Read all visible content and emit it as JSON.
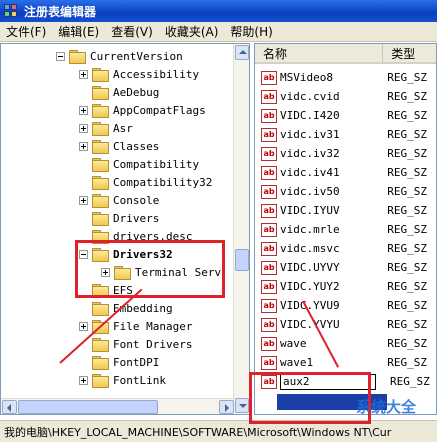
{
  "window": {
    "title": "注册表编辑器"
  },
  "menu": [
    "文件(F)",
    "编辑(E)",
    "查看(V)",
    "收藏夹(A)",
    "帮助(H)"
  ],
  "tree": [
    {
      "label": "CurrentVersion",
      "expander": "minus",
      "level": 0
    },
    {
      "label": "Accessibility",
      "expander": "plus",
      "level": 1
    },
    {
      "label": "AeDebug",
      "expander": "none",
      "level": 1
    },
    {
      "label": "AppCompatFlags",
      "expander": "plus",
      "level": 1
    },
    {
      "label": "Asr",
      "expander": "plus",
      "level": 1
    },
    {
      "label": "Classes",
      "expander": "plus",
      "level": 1
    },
    {
      "label": "Compatibility",
      "expander": "none",
      "level": 1
    },
    {
      "label": "Compatibility32",
      "expander": "none",
      "level": 1
    },
    {
      "label": "Console",
      "expander": "plus",
      "level": 1
    },
    {
      "label": "Drivers",
      "expander": "none",
      "level": 1
    },
    {
      "label": "drivers.desc",
      "expander": "none",
      "level": 1
    },
    {
      "label": "Drivers32",
      "expander": "minus",
      "level": 1,
      "selected": true
    },
    {
      "label": "Terminal Serv",
      "expander": "plus",
      "level": 2
    },
    {
      "label": "EFS",
      "expander": "none",
      "level": 1
    },
    {
      "label": "Embedding",
      "expander": "none",
      "level": 1
    },
    {
      "label": "File Manager",
      "expander": "plus",
      "level": 1
    },
    {
      "label": "Font Drivers",
      "expander": "none",
      "level": 1
    },
    {
      "label": "FontDPI",
      "expander": "none",
      "level": 1
    },
    {
      "label": "FontLink",
      "expander": "plus",
      "level": 1
    }
  ],
  "list": {
    "headers": {
      "name": "名称",
      "type": "类型"
    },
    "rows": [
      {
        "name": "MSVideo8",
        "type": "REG_SZ"
      },
      {
        "name": "vidc.cvid",
        "type": "REG_SZ"
      },
      {
        "name": "VIDC.I420",
        "type": "REG_SZ"
      },
      {
        "name": "vidc.iv31",
        "type": "REG_SZ"
      },
      {
        "name": "vidc.iv32",
        "type": "REG_SZ"
      },
      {
        "name": "vidc.iv41",
        "type": "REG_SZ"
      },
      {
        "name": "vidc.iv50",
        "type": "REG_SZ"
      },
      {
        "name": "VIDC.IYUV",
        "type": "REG_SZ"
      },
      {
        "name": "vidc.mrle",
        "type": "REG_SZ"
      },
      {
        "name": "vidc.msvc",
        "type": "REG_SZ"
      },
      {
        "name": "VIDC.UYVY",
        "type": "REG_SZ"
      },
      {
        "name": "VIDC.YUY2",
        "type": "REG_SZ"
      },
      {
        "name": "VIDC.YVU9",
        "type": "REG_SZ"
      },
      {
        "name": "VIDC.YVYU",
        "type": "REG_SZ"
      },
      {
        "name": "wave",
        "type": "REG_SZ"
      },
      {
        "name": "wave1",
        "type": "REG_SZ"
      }
    ],
    "rename_value": "aux2",
    "rename_type": "REG_SZ"
  },
  "status": "我的电脑\\HKEY_LOCAL_MACHINE\\SOFTWARE\\Microsoft\\Windows NT\\Cur",
  "icons": {
    "value": "ab",
    "app": "registry-editor-icon"
  },
  "watermark": {
    "text": "系统大全"
  },
  "colors": {
    "highlight": "#e0202a",
    "title_bar": "#0a3fbf"
  }
}
